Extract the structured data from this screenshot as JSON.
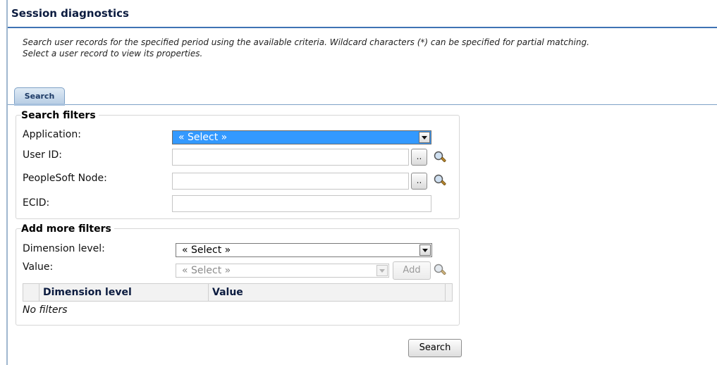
{
  "page": {
    "title": "Session diagnostics",
    "description_line1": "Search user records for the specified period using the available criteria. Wildcard characters (*) can be specified for partial matching.",
    "description_line2": "Select a user record to view its properties."
  },
  "tabs": [
    {
      "label": "Search",
      "active": true
    }
  ],
  "search_filters": {
    "legend": "Search filters",
    "application": {
      "label": "Application:",
      "value": "« Select »"
    },
    "user_id": {
      "label": "User ID:",
      "value": "",
      "picker_label": ".."
    },
    "node": {
      "label": "PeopleSoft Node:",
      "value": "",
      "picker_label": ".."
    },
    "ecid": {
      "label": "ECID:",
      "value": ""
    }
  },
  "more_filters": {
    "legend": "Add more filters",
    "dimension_level": {
      "label": "Dimension level:",
      "value": "« Select »"
    },
    "value": {
      "label": "Value:",
      "value": "« Select »",
      "enabled": false
    },
    "add_label": "Add",
    "table": {
      "columns": [
        "Dimension level",
        "Value"
      ],
      "empty_text": "No filters"
    }
  },
  "search_button": "Search",
  "colors": {
    "accent": "#3f73b4",
    "selected_highlight": "#3399ff",
    "title": "#0b1b3f"
  },
  "icons": {
    "lookup": "magnifier-lookup-icon",
    "dropdown": "chevron-down-icon"
  }
}
